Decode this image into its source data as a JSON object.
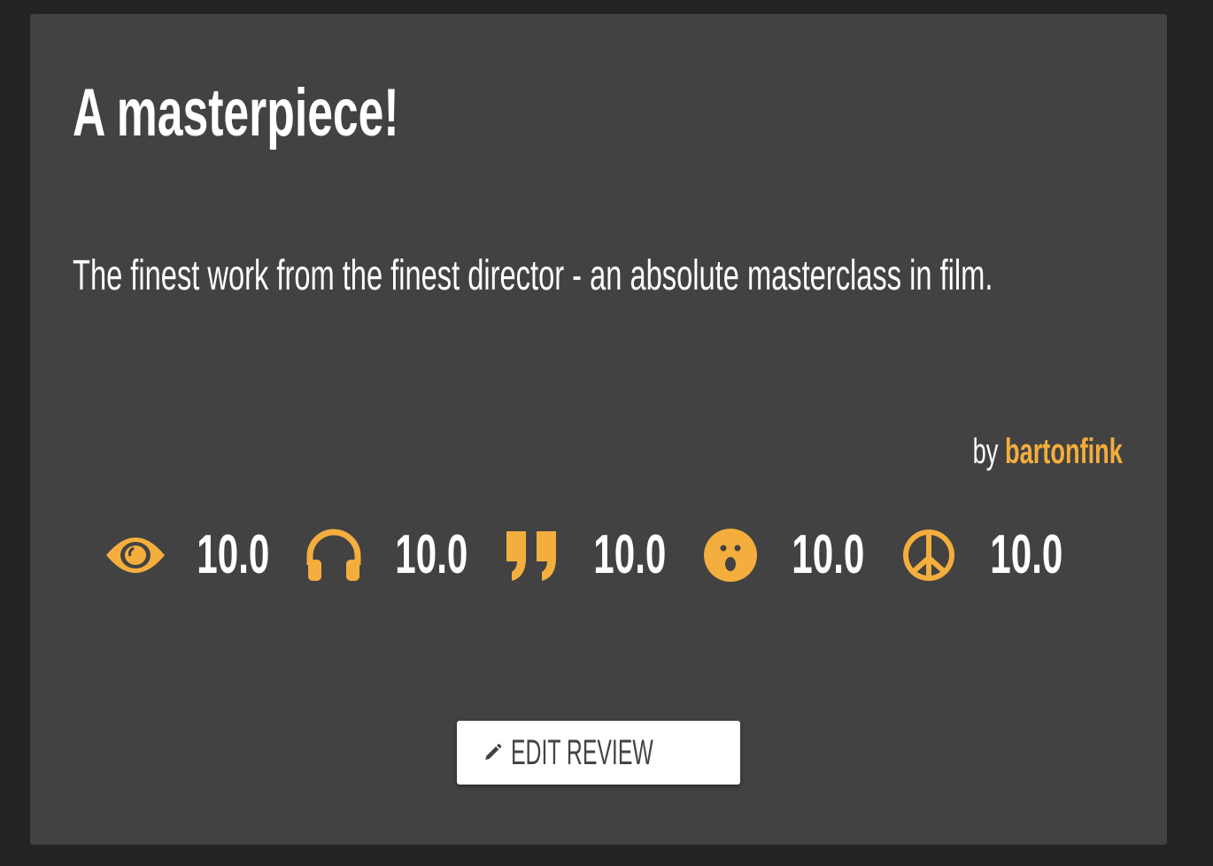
{
  "review": {
    "title": "A masterpiece!",
    "body": "The finest work from the finest director - an absolute masterclass in film.",
    "by_label": "by",
    "author": "bartonfink"
  },
  "ratings": [
    {
      "icon": "eye-icon",
      "value": "10.0"
    },
    {
      "icon": "headphones-icon",
      "value": "10.0"
    },
    {
      "icon": "quote-icon",
      "value": "10.0"
    },
    {
      "icon": "surprised-face-icon",
      "value": "10.0"
    },
    {
      "icon": "peace-icon",
      "value": "10.0"
    }
  ],
  "actions": {
    "edit_label": "EDIT REVIEW",
    "edit_icon": "pencil-icon"
  },
  "colors": {
    "accent": "#f4ae3d",
    "card": "#424242",
    "background": "#232323"
  }
}
